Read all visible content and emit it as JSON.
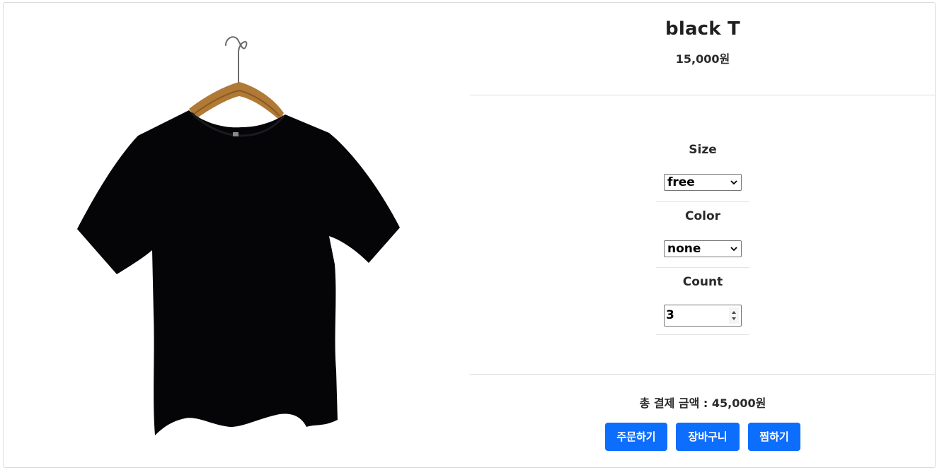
{
  "product": {
    "name": "black T",
    "price": "15,000원",
    "image_icon": "black-tshirt-on-hanger"
  },
  "options": {
    "size": {
      "label": "Size",
      "selected": "free"
    },
    "color": {
      "label": "Color",
      "selected": "none"
    },
    "count": {
      "label": "Count",
      "value": "3"
    }
  },
  "summary": {
    "total_text": "총 결제 금액 : 45,000원"
  },
  "actions": {
    "order_label": "주문하기",
    "cart_label": "장바구니",
    "wishlist_label": "찜하기"
  },
  "colors": {
    "accent": "#0d6efd",
    "divider": "#dddddd"
  }
}
